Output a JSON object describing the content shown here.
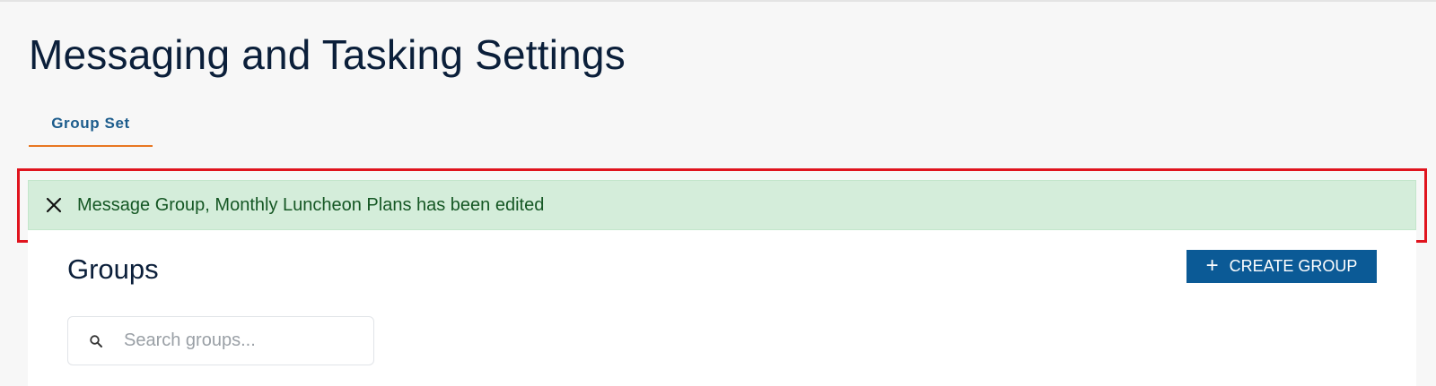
{
  "page": {
    "title": "Messaging and Tasking Settings"
  },
  "tabs": [
    {
      "label": "Group Set",
      "active": true
    }
  ],
  "alert": {
    "message": "Message Group, Monthly Luncheon Plans has been edited",
    "type": "success",
    "close_icon": "close-icon"
  },
  "groups": {
    "heading": "Groups",
    "create_button_label": "CREATE GROUP",
    "create_button_icon": "plus-icon",
    "search": {
      "placeholder": "Search groups...",
      "value": "",
      "icon": "search-icon"
    }
  },
  "colors": {
    "title": "#0b1f3a",
    "tab_text": "#1c5c8c",
    "tab_underline": "#e87722",
    "alert_bg": "#d4edda",
    "alert_text": "#155724",
    "primary_button": "#0b5a96",
    "highlight_frame": "#e0141e"
  }
}
